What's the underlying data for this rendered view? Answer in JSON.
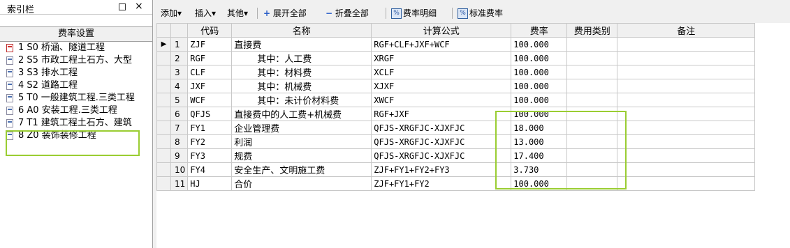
{
  "left_panel": {
    "title": "索引栏",
    "pin_symbol": "□",
    "close_symbol": "×",
    "header": "费率设置",
    "items": [
      {
        "label": "1 S0 桥涵、隧道工程",
        "icon": "red-doc-icon"
      },
      {
        "label": "2 S5 市政工程土石方、大型",
        "icon": "doc-icon"
      },
      {
        "label": "3 S3 排水工程",
        "icon": "doc-icon"
      },
      {
        "label": "4 S2 道路工程",
        "icon": "doc-icon"
      },
      {
        "label": "5 T0 一般建筑工程.三类工程",
        "icon": "doc-icon"
      },
      {
        "label": "6 A0 安装工程.三类工程",
        "icon": "doc-icon"
      },
      {
        "label": "7 T1 建筑工程土石方、建筑",
        "icon": "doc-icon"
      },
      {
        "label": "8 Z0 装饰装修工程",
        "icon": "doc-icon"
      }
    ]
  },
  "toolbar": {
    "add": "添加",
    "insert": "插入",
    "other": "其他",
    "arrow": "▾",
    "expand_all": "展开全部",
    "collapse_all": "折叠全部",
    "rate_detail": "费率明细",
    "standard_rate": "标准费率",
    "plus_glyph": "+",
    "minus_glyph": "−",
    "pct_glyph": "%"
  },
  "grid": {
    "columns": [
      "代码",
      "名称",
      "计算公式",
      "费率",
      "费用类别",
      "备注"
    ],
    "current_row_marker": "▶",
    "rows": [
      {
        "no": "1",
        "code": "ZJF",
        "name": "直接费",
        "formula": "RGF+CLF+JXF+WCF",
        "rate": "100.000",
        "category": "",
        "note": ""
      },
      {
        "no": "2",
        "code": "RGF",
        "name": "其中：人工费",
        "formula": "XRGF",
        "rate": "100.000",
        "category": "",
        "note": ""
      },
      {
        "no": "3",
        "code": "CLF",
        "name": "其中：材料费",
        "formula": "XCLF",
        "rate": "100.000",
        "category": "",
        "note": ""
      },
      {
        "no": "4",
        "code": "JXF",
        "name": "其中：机械费",
        "formula": "XJXF",
        "rate": "100.000",
        "category": "",
        "note": ""
      },
      {
        "no": "5",
        "code": "WCF",
        "name": "其中：未计价材料费",
        "formula": "XWCF",
        "rate": "100.000",
        "category": "",
        "note": ""
      },
      {
        "no": "6",
        "code": "QFJS",
        "name": "直接费中的人工费+机械费",
        "formula": "RGF+JXF",
        "rate": "100.000",
        "category": "",
        "note": ""
      },
      {
        "no": "7",
        "code": "FY1",
        "name": "企业管理费",
        "formula": "QFJS-XRGFJC-XJXFJC",
        "rate": "18.000",
        "category": "",
        "note": ""
      },
      {
        "no": "8",
        "code": "FY2",
        "name": "利润",
        "formula": "QFJS-XRGFJC-XJXFJC",
        "rate": "13.000",
        "category": "",
        "note": ""
      },
      {
        "no": "9",
        "code": "FY3",
        "name": "规费",
        "formula": "QFJS-XRGFJC-XJXFJC",
        "rate": "17.400",
        "category": "",
        "note": ""
      },
      {
        "no": "10",
        "code": "FY4",
        "name": "安全生产、文明施工费",
        "formula": "ZJF+FY1+FY2+FY3",
        "rate": "3.730",
        "category": "",
        "note": ""
      },
      {
        "no": "11",
        "code": "HJ",
        "name": "合价",
        "formula": "ZJF+FY1+FY2",
        "rate": "100.000",
        "category": "",
        "note": ""
      }
    ]
  },
  "colors": {
    "highlight": "#9acd32",
    "accent_blue": "#2a5ec8"
  }
}
